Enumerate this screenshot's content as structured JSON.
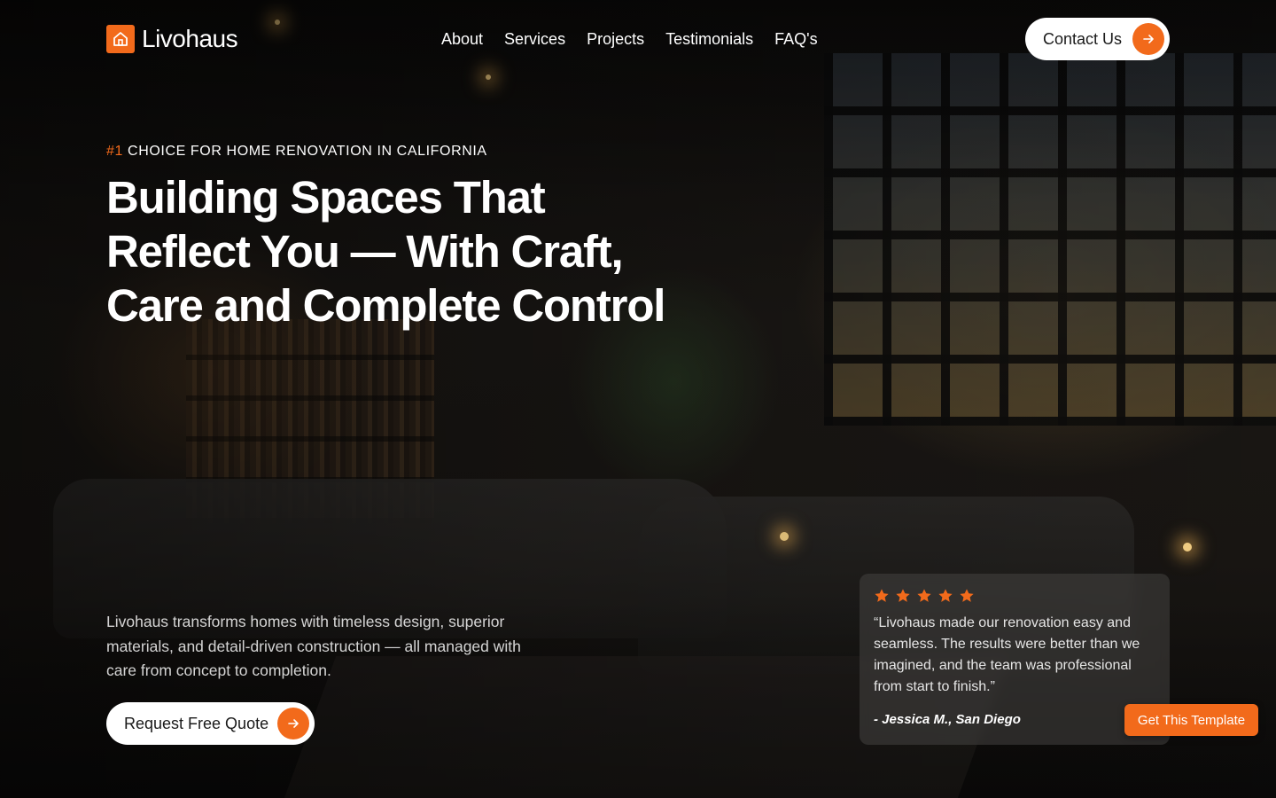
{
  "brand": {
    "name": "Livohaus",
    "accent_color": "#f26a1b",
    "logo_icon": "house-icon"
  },
  "nav": {
    "items": [
      {
        "label": "About"
      },
      {
        "label": "Services"
      },
      {
        "label": "Projects"
      },
      {
        "label": "Testimonials"
      },
      {
        "label": "FAQ's"
      }
    ],
    "contact_label": "Contact Us"
  },
  "hero": {
    "eyebrow_hash": "#1",
    "eyebrow_text": "CHOICE FOR HOME RENOVATION IN CALIFORNIA",
    "headline": "Building Spaces That Reflect You — With Craft, Care and Complete Control",
    "subtext": "Livohaus transforms homes with timeless design, superior materials, and detail-driven construction — all managed with care from concept to completion.",
    "cta_label": "Request Free Quote"
  },
  "testimonial": {
    "rating": 5,
    "quote": "“Livohaus made our renovation easy and seamless. The results were better than we imagined, and the team was professional from start to finish.”",
    "author": "- Jessica M., San Diego"
  },
  "template_button": {
    "label": "Get This Template"
  }
}
